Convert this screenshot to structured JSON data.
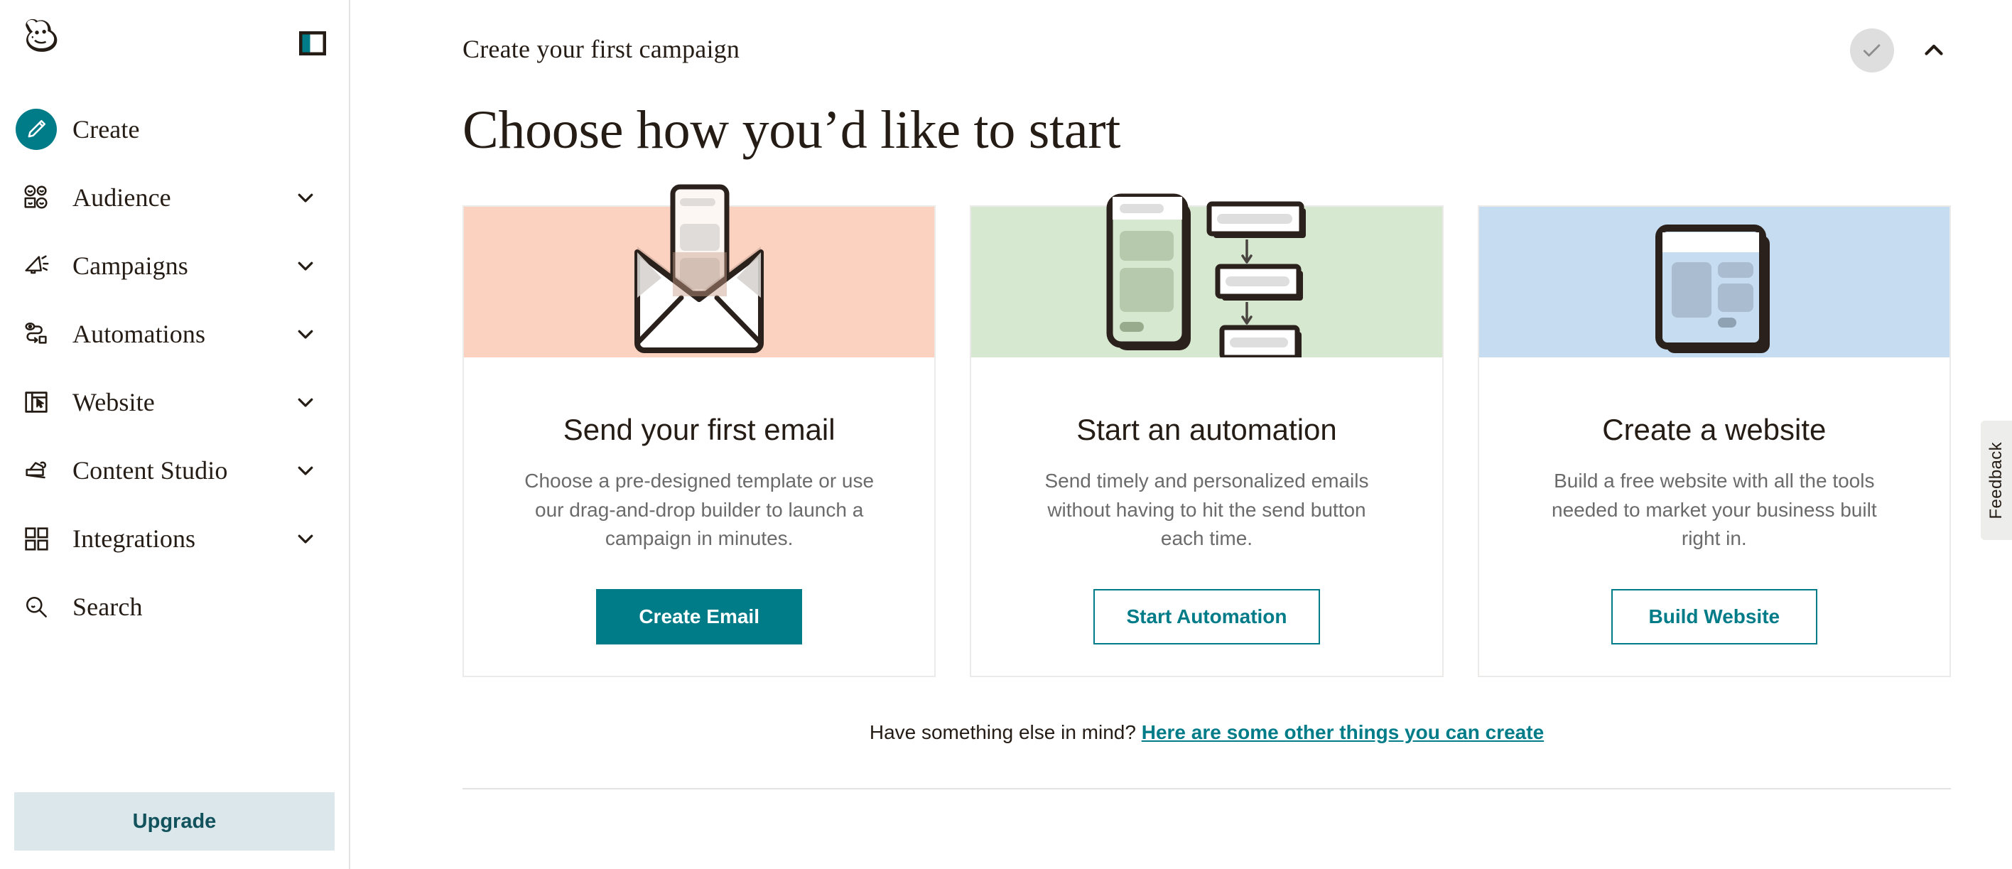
{
  "sidebar": {
    "logo_icon": "mailchimp-freddie-logo",
    "panel_toggle_icon": "panel-collapse-icon",
    "items": [
      {
        "label": "Create",
        "icon": "pencil-icon",
        "has_chevron": false,
        "active": true
      },
      {
        "label": "Audience",
        "icon": "audience-people-icon",
        "has_chevron": true,
        "active": false
      },
      {
        "label": "Campaigns",
        "icon": "megaphone-icon",
        "has_chevron": true,
        "active": false
      },
      {
        "label": "Automations",
        "icon": "automation-flow-icon",
        "has_chevron": true,
        "active": false
      },
      {
        "label": "Website",
        "icon": "website-layout-icon",
        "has_chevron": true,
        "active": false
      },
      {
        "label": "Content Studio",
        "icon": "content-studio-icon",
        "has_chevron": true,
        "active": false
      },
      {
        "label": "Integrations",
        "icon": "grid-squares-icon",
        "has_chevron": true,
        "active": false
      },
      {
        "label": "Search",
        "icon": "search-icon",
        "has_chevron": false,
        "active": false
      }
    ],
    "upgrade_label": "Upgrade"
  },
  "header": {
    "eyebrow": "Create your first campaign",
    "status_icon": "checkmark-icon",
    "collapse_icon": "chevron-up-icon"
  },
  "main": {
    "title": "Choose how you’d like to start",
    "cards": [
      {
        "title": "Send your first email",
        "description": "Choose a pre-designed template or use our drag-and-drop builder to launch a campaign in minutes.",
        "cta": "Create Email",
        "cta_style": "solid",
        "art": "open-envelope-illustration",
        "band_color": "#fbd1c0"
      },
      {
        "title": "Start an automation",
        "description": "Send timely and personalized emails without having to hit the send button each time.",
        "cta": "Start Automation",
        "cta_style": "outline",
        "art": "phone-flowchart-illustration",
        "band_color": "#d6e8cf"
      },
      {
        "title": "Create a website",
        "description": "Build a free website with all the tools needed to market your business built right in.",
        "cta": "Build Website",
        "cta_style": "outline",
        "art": "browser-window-illustration",
        "band_color": "#c6dcf0"
      }
    ],
    "footnote_text": "Have something else in mind? ",
    "footnote_link": "Here are some other things you can create"
  },
  "feedback": {
    "label": "Feedback"
  },
  "colors": {
    "accent_teal": "#007c89",
    "upgrade_bg": "#dbe7ea",
    "upgrade_text": "#11525c",
    "ink": "#241c15",
    "muted_text": "#6b6b6b",
    "card_border": "#eceae8"
  }
}
